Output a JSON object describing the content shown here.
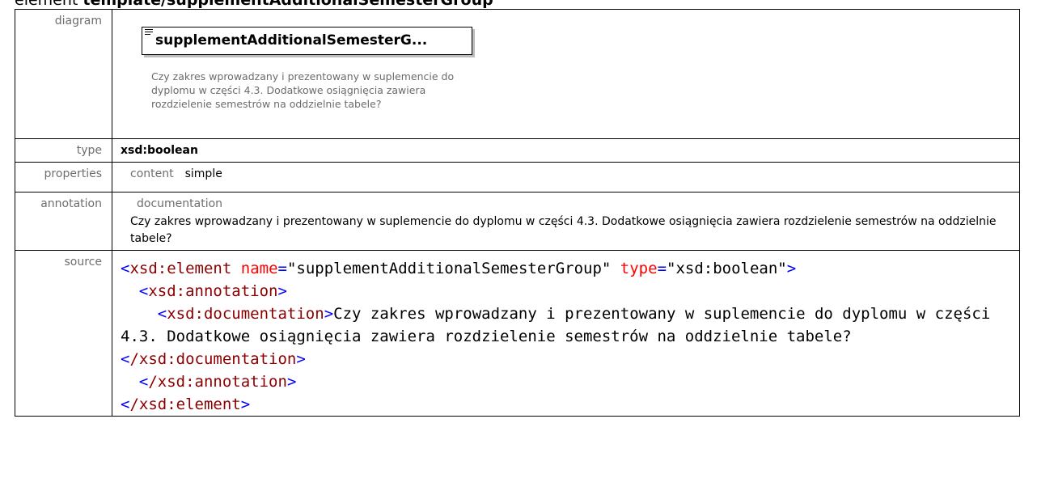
{
  "heading": {
    "prefix": "element ",
    "name": "template/supplementAdditionalSemesterGroup"
  },
  "labels": {
    "diagram": "diagram",
    "type": "type",
    "properties": "properties",
    "annotation": "annotation",
    "source": "source"
  },
  "diagram": {
    "box_title": "supplementAdditionalSemesterG...",
    "doc": "Czy zakres wprowadzany i prezentowany w suplemencie do dyplomu w części 4.3. Dodatkowe osiągnięcia zawiera rozdzielenie semestrów na oddzielnie tabele?"
  },
  "type_value": "xsd:boolean",
  "properties": {
    "key": "content",
    "value": "simple"
  },
  "annotation": {
    "key": "documentation",
    "text": "Czy zakres wprowadzany i prezentowany w suplemencie do dyplomu w części 4.3. Dodatkowe osiągnięcia zawiera rozdzielenie semestrów na oddzielnie tabele?"
  },
  "source": {
    "line1_tag": "xsd:element",
    "line1_attr1": "name",
    "line1_val1": "\"supplementAdditionalSemesterGroup\"",
    "line1_attr2": "type",
    "line1_val2": "\"xsd:boolean\"",
    "annotation_tag": "xsd:annotation",
    "documentation_tag": "xsd:documentation",
    "documentation_text": "Czy zakres wprowadzany i prezentowany w suplemencie do dyplomu w części 4.3. Dodatkowe osiągnięcia zawiera rozdzielenie semestrów na oddzielnie tabele?",
    "close_documentation": "/xsd:documentation",
    "close_annotation": "/xsd:annotation",
    "close_element": "/xsd:element"
  },
  "colors": {
    "tag": "#0000ff",
    "tag_name": "#8b0000",
    "attr_name": "#ff0000",
    "label_gray": "#6e6e6e"
  }
}
